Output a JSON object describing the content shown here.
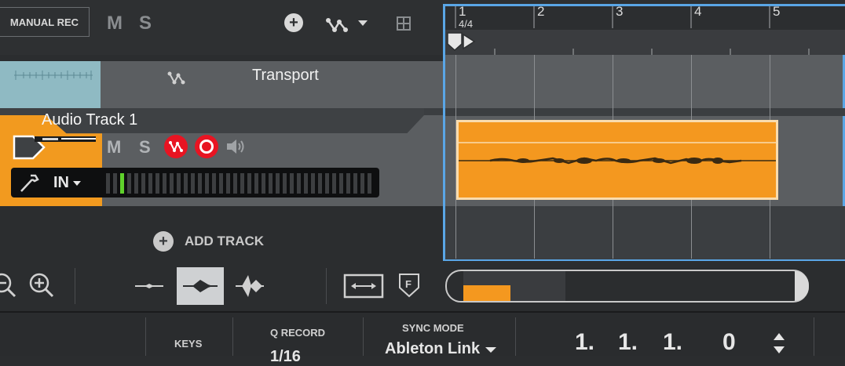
{
  "header": {
    "record_mode": "MANUAL REC",
    "mute": "M",
    "solo": "S",
    "add_icon": "plus-circle-icon",
    "automation_icon": "automation-icon",
    "grid_icon": "grid-icon"
  },
  "ruler": {
    "bars": [
      "1",
      "2",
      "3",
      "4",
      "5"
    ],
    "time_signature": "4/4"
  },
  "transport": {
    "label": "Transport",
    "icon": "automation-icon"
  },
  "track": {
    "name": "Audio Track 1",
    "mute": "M",
    "solo": "S",
    "input": "IN",
    "color": "#f29a1f"
  },
  "add_track": {
    "label": "ADD TRACK"
  },
  "status": {
    "keys_label": "KEYS",
    "q_record_label": "Q RECORD",
    "q_record_value": "1/16",
    "sync_mode_label": "SYNC MODE",
    "sync_mode_value": "Ableton Link",
    "position": [
      "1.",
      "1.",
      "1.",
      "0"
    ]
  },
  "colors": {
    "accent": "#f29a1f",
    "selection": "#5aa6e6",
    "record": "#e81422"
  }
}
